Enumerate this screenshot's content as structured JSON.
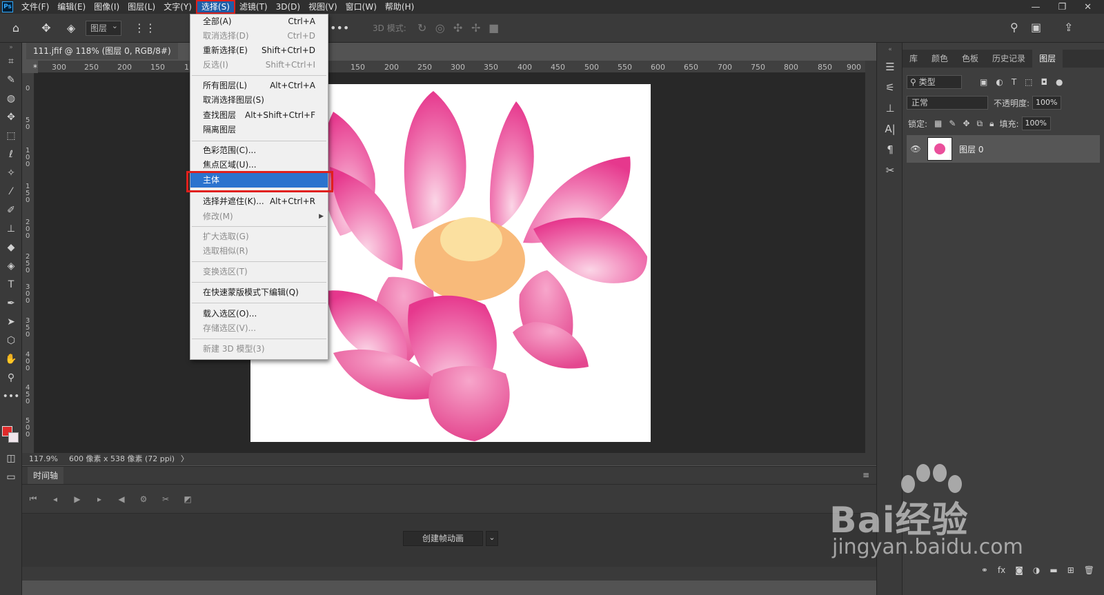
{
  "app": {
    "logo": "Ps"
  },
  "menu": [
    "文件(F)",
    "编辑(E)",
    "图像(I)",
    "图层(L)",
    "文字(Y)",
    "选择(S)",
    "滤镜(T)",
    "3D(D)",
    "视图(V)",
    "窗口(W)",
    "帮助(H)"
  ],
  "active_menu_index": 5,
  "window_controls": [
    "—",
    "❐",
    "✕"
  ],
  "options_bar": {
    "layer_select": "图层",
    "threed_mode": "3D 模式:"
  },
  "document": {
    "tab_title": "111.jfif @ 118% (图层 0, RGB/8#) *",
    "close": "×"
  },
  "ruler_top": [
    "300",
    "250",
    "200",
    "150",
    "1",
    "150",
    "200",
    "250",
    "300",
    "350",
    "400",
    "450",
    "500",
    "550",
    "600",
    "650",
    "700",
    "750",
    "800",
    "850",
    "900"
  ],
  "ruler_left": [
    "0",
    "50",
    "100",
    "150",
    "200",
    "250",
    "300",
    "350",
    "400",
    "450",
    "500"
  ],
  "status": {
    "zoom": "117.9%",
    "size": "600 像素 x 538 像素 (72 ppi)",
    "arrow": "〉"
  },
  "timeline": {
    "tab": "时间轴",
    "create_button": "创建帧动画",
    "dropdown": "⌄"
  },
  "dropdown_menu": [
    {
      "label": "全部(A)",
      "shortcut": "Ctrl+A",
      "disabled": false
    },
    {
      "label": "取消选择(D)",
      "shortcut": "Ctrl+D",
      "disabled": true
    },
    {
      "label": "重新选择(E)",
      "shortcut": "Shift+Ctrl+D",
      "disabled": false
    },
    {
      "label": "反选(I)",
      "shortcut": "Shift+Ctrl+I",
      "disabled": true
    },
    {
      "label": "所有图层(L)",
      "shortcut": "Alt+Ctrl+A",
      "disabled": false
    },
    {
      "label": "取消选择图层(S)",
      "shortcut": "",
      "disabled": false
    },
    {
      "label": "查找图层",
      "shortcut": "Alt+Shift+Ctrl+F",
      "disabled": false
    },
    {
      "label": "隔离图层",
      "shortcut": "",
      "disabled": false
    },
    {
      "label": "色彩范围(C)...",
      "shortcut": "",
      "disabled": false
    },
    {
      "label": "焦点区域(U)...",
      "shortcut": "",
      "disabled": false
    },
    {
      "label": "主体",
      "shortcut": "",
      "disabled": false
    },
    {
      "label": "选择并遮住(K)...",
      "shortcut": "Alt+Ctrl+R",
      "disabled": false
    },
    {
      "label": "修改(M)",
      "shortcut": "",
      "disabled": true
    },
    {
      "label": "扩大选取(G)",
      "shortcut": "",
      "disabled": true
    },
    {
      "label": "选取相似(R)",
      "shortcut": "",
      "disabled": true
    },
    {
      "label": "变换选区(T)",
      "shortcut": "",
      "disabled": true
    },
    {
      "label": "在快速蒙版模式下编辑(Q)",
      "shortcut": "",
      "disabled": false
    },
    {
      "label": "载入选区(O)...",
      "shortcut": "",
      "disabled": false
    },
    {
      "label": "存储选区(V)...",
      "shortcut": "",
      "disabled": true
    },
    {
      "label": "新建 3D 模型(3)",
      "shortcut": "",
      "disabled": true
    }
  ],
  "highlighted_item": "主体",
  "layers_panel": {
    "tabs": [
      "库",
      "颜色",
      "色板",
      "历史记录",
      "图层"
    ],
    "active_tab": "图层",
    "kind_filter": "类型",
    "blend_mode": "正常",
    "opacity_label": "不透明度:",
    "opacity_value": "100%",
    "lock_label": "锁定:",
    "fill_label": "填充:",
    "fill_value": "100%",
    "layer_name": "图层 0"
  },
  "watermark": {
    "brand": "Bai经验",
    "url": "jingyan.baidu.com"
  },
  "colors": {
    "highlight": "#2b73ce",
    "annotation_red": "#e0201c",
    "foreground": "#e02a2a"
  }
}
